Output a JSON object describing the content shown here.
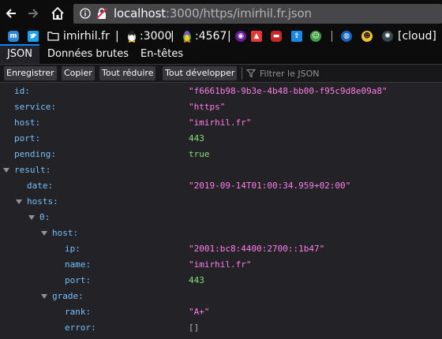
{
  "browser": {
    "url_host": "localhost",
    "url_path": ":3000/https/imirhil.fr.json"
  },
  "bookmarks": [
    {
      "icon": "mastodon-icon",
      "label": ""
    },
    {
      "icon": "twitter-icon",
      "label": ""
    },
    {
      "icon": "folder-icon",
      "label": "imirhil.fr"
    },
    {
      "icon": "separator",
      "label": "|"
    },
    {
      "icon": "tux-icon",
      "label": ":3000"
    },
    {
      "icon": "separator",
      "label": "|"
    },
    {
      "icon": "tux-color-icon",
      "label": ":4567"
    },
    {
      "icon": "separator",
      "label": "|"
    },
    {
      "icon": "cloud-label",
      "label": "[cloud]"
    }
  ],
  "tabs": [
    "JSON",
    "Données brutes",
    "En-têtes"
  ],
  "toolbar": {
    "save": "Enregistrer",
    "copy": "Copier",
    "collapse_all": "Tout réduire",
    "expand_all": "Tout développer",
    "filter_placeholder": "Filtrer le JSON"
  },
  "json": {
    "id": {
      "key": "id:",
      "value": "\"f6661b98-9b3e-4b48-bb00-f95c9d8e09a8\""
    },
    "service": {
      "key": "service:",
      "value": "\"https\""
    },
    "host": {
      "key": "host:",
      "value": "\"imirhil.fr\""
    },
    "port": {
      "key": "port:",
      "value": "443"
    },
    "pending": {
      "key": "pending:",
      "value": "true"
    },
    "result": {
      "key": "result:"
    },
    "date": {
      "key": "date:",
      "value": "\"2019-09-14T01:00:34.959+02:00\""
    },
    "hosts": {
      "key": "hosts:"
    },
    "idx0": {
      "key": "0:"
    },
    "host_obj": {
      "key": "host:"
    },
    "ip": {
      "key": "ip:",
      "value": "\"2001:bc8:4400:2700::1b47\""
    },
    "name": {
      "key": "name:",
      "value": "\"imirhil.fr\""
    },
    "port2": {
      "key": "port:",
      "value": "443"
    },
    "grade": {
      "key": "grade:"
    },
    "rank": {
      "key": "rank:",
      "value": "\"A+\""
    },
    "error": {
      "key": "error:",
      "value": "[]"
    }
  },
  "colors": {
    "key": "#75bfff",
    "string": "#ff7de9",
    "number": "#86de74",
    "tab_active": "#0a84ff"
  }
}
